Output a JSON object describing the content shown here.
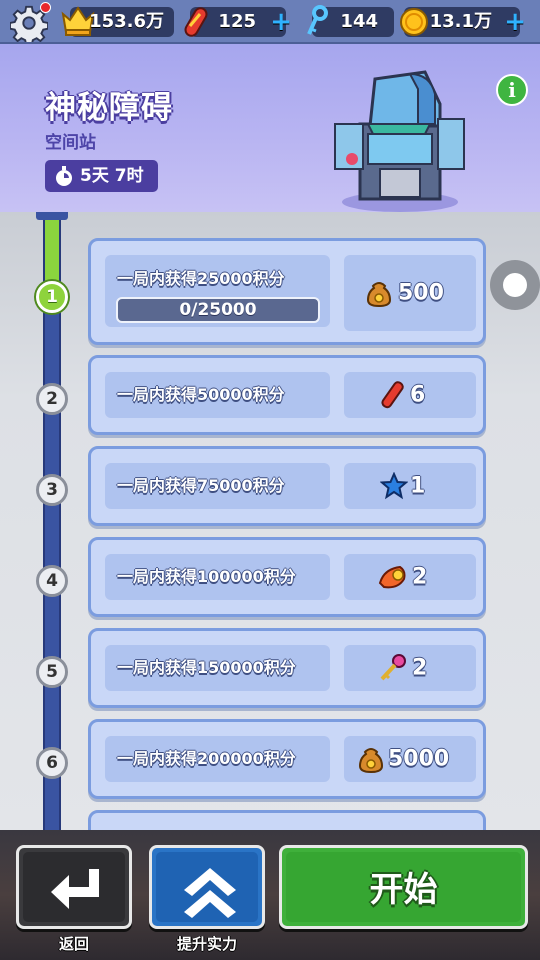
{
  "topbar": {
    "crowns": "153.6万",
    "boards": "125",
    "keys": "144",
    "coins": "13.1万",
    "plus": "+"
  },
  "header": {
    "title": "神秘障碍",
    "subtitle": "空间站",
    "timer": "5天 7时",
    "info": "i"
  },
  "progress": {
    "current": 0,
    "target": 25000,
    "text": "0/25000"
  },
  "missions": [
    {
      "step": "1",
      "task": "一局内获得25000积分",
      "reward_icon": "coin-bag-icon",
      "reward": "500",
      "active": true
    },
    {
      "step": "2",
      "task": "一局内获得50000积分",
      "reward_icon": "hoverboard-icon",
      "reward": "6",
      "active": false
    },
    {
      "step": "3",
      "task": "一局内获得75000积分",
      "reward_icon": "star-icon",
      "reward": "1",
      "active": false
    },
    {
      "step": "4",
      "task": "一局内获得100000积分",
      "reward_icon": "score-booster-icon",
      "reward": "2",
      "active": false
    },
    {
      "step": "5",
      "task": "一局内获得150000积分",
      "reward_icon": "key-icon",
      "reward": "2",
      "active": false
    },
    {
      "step": "6",
      "task": "一局内获得200000积分",
      "reward_icon": "coin-bag-icon",
      "reward": "5000",
      "active": false
    }
  ],
  "buttons": {
    "back_label": "返回",
    "upgrade_label": "提升实力",
    "start_label": "开始"
  },
  "colors": {
    "accent_green": "#3fb03b",
    "header_purple": "#a6a6ee",
    "card_blue": "#c9d7f7",
    "track_blue": "#3a54a2"
  }
}
